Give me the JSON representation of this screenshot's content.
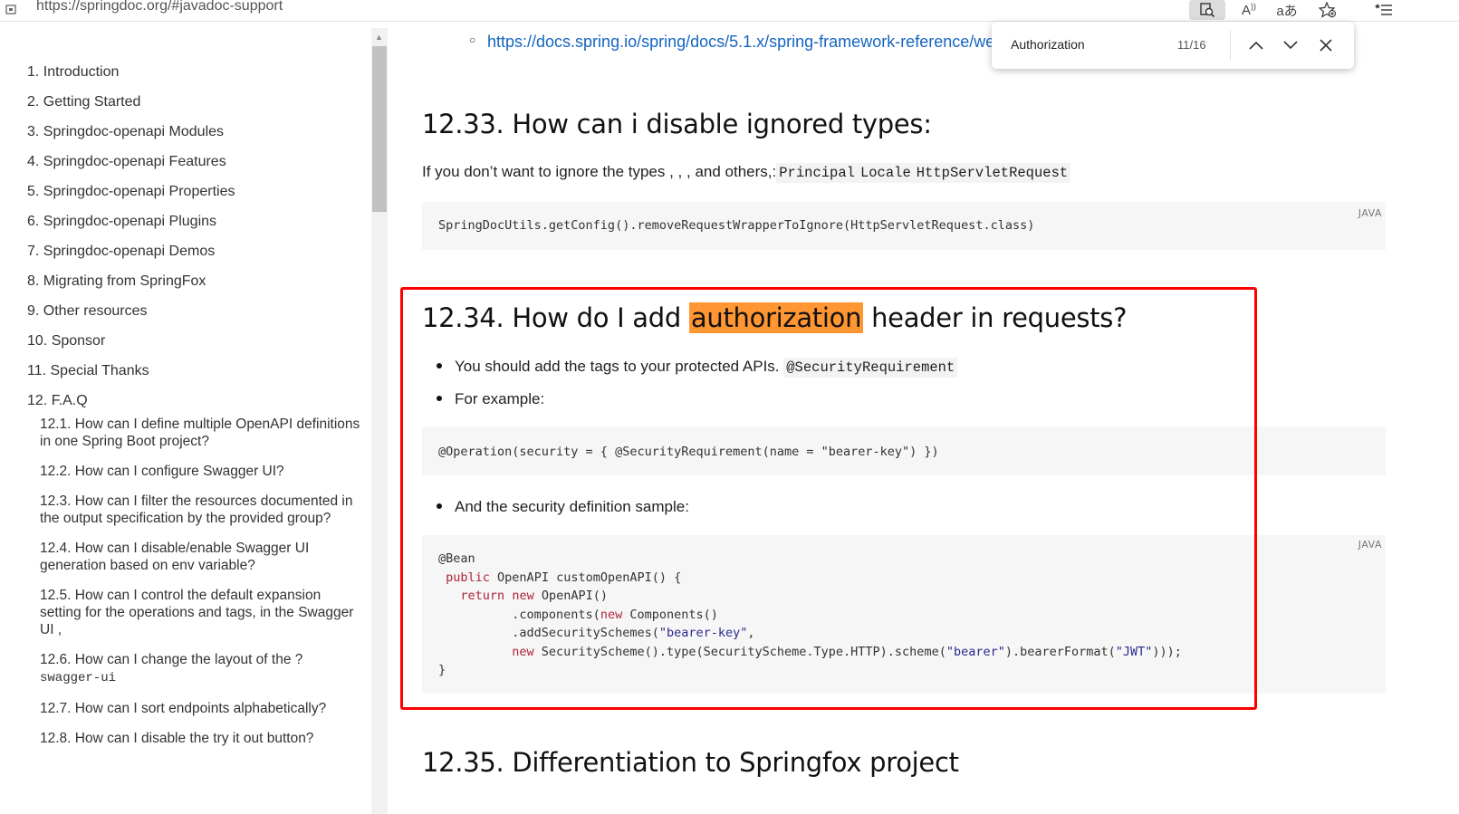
{
  "browser": {
    "url": "https://springdoc.org/#javadoc-support",
    "toolbar_icons": [
      "find-icon",
      "read-aloud-icon",
      "translate-icon",
      "favorite-add-icon",
      "collections-icon"
    ]
  },
  "find_bar": {
    "query": "Authorization",
    "count": "11/16"
  },
  "sidebar": {
    "items": [
      "1. Introduction",
      "2. Getting Started",
      "3. Springdoc-openapi Modules",
      "4. Springdoc-openapi Features",
      "5. Springdoc-openapi Properties",
      "6. Springdoc-openapi Plugins",
      "7. Springdoc-openapi Demos",
      "8. Migrating from SpringFox",
      "9. Other resources",
      "10. Sponsor",
      "11. Special Thanks",
      "12. F.A.Q"
    ],
    "sub_items": [
      "12.1. How can I define multiple OpenAPI definitions in one Spring Boot project?",
      "12.2. How can I configure Swagger UI?",
      "12.3. How can I filter the resources documented in the output specification by the provided group?",
      "12.4. How can I disable/enable Swagger UI generation based on env variable?",
      "12.5. How can I control the default expansion setting for the operations and tags, in the Swagger UI ,",
      "12.6. How can I change the layout of the ?",
      "12.7. How can I sort endpoints alphabetically?",
      "12.8. How can I disable the try it out button?"
    ],
    "sub_item_6_code": "swagger-ui"
  },
  "content": {
    "top_link": "https://docs.spring.io/spring/docs/5.1.x/spring-framework-reference/we",
    "section_33": {
      "title": "12.33. How can i disable ignored types:",
      "text": "If you don’t want to ignore the types , , , and others,:",
      "codes": [
        "Principal",
        "Locale",
        "HttpServletRequest"
      ],
      "code_block": "SpringDocUtils.getConfig().removeRequestWrapperToIgnore(HttpServletRequest.class)",
      "lang": "JAVA"
    },
    "section_34": {
      "title_before": "12.34. How do I add ",
      "title_mark": "authorization",
      "title_after": " header in requests?",
      "bullet1": "You should add the tags to your protected APIs.",
      "bullet1_code": "@SecurityRequirement",
      "bullet2": "For example:",
      "code_block1": "@Operation(security = { @SecurityRequirement(name = \"bearer-key\") })",
      "bullet3": "And the security definition sample:",
      "lang": "JAVA",
      "code_lines": [
        "@Bean",
        " public OpenAPI customOpenAPI() {",
        "   return new OpenAPI()",
        "          .components(new Components()",
        "          .addSecuritySchemes(\"bearer-key\",",
        "          new SecurityScheme().type(SecurityScheme.Type.HTTP).scheme(\"bearer\").bearerFormat(\"JWT\")));",
        "}"
      ]
    },
    "section_35": {
      "title": "12.35. Differentiation to Springfox project"
    }
  },
  "colors": {
    "highlight": "#ff9632",
    "annotation_box": "#ff0000",
    "link": "#1565c0"
  }
}
